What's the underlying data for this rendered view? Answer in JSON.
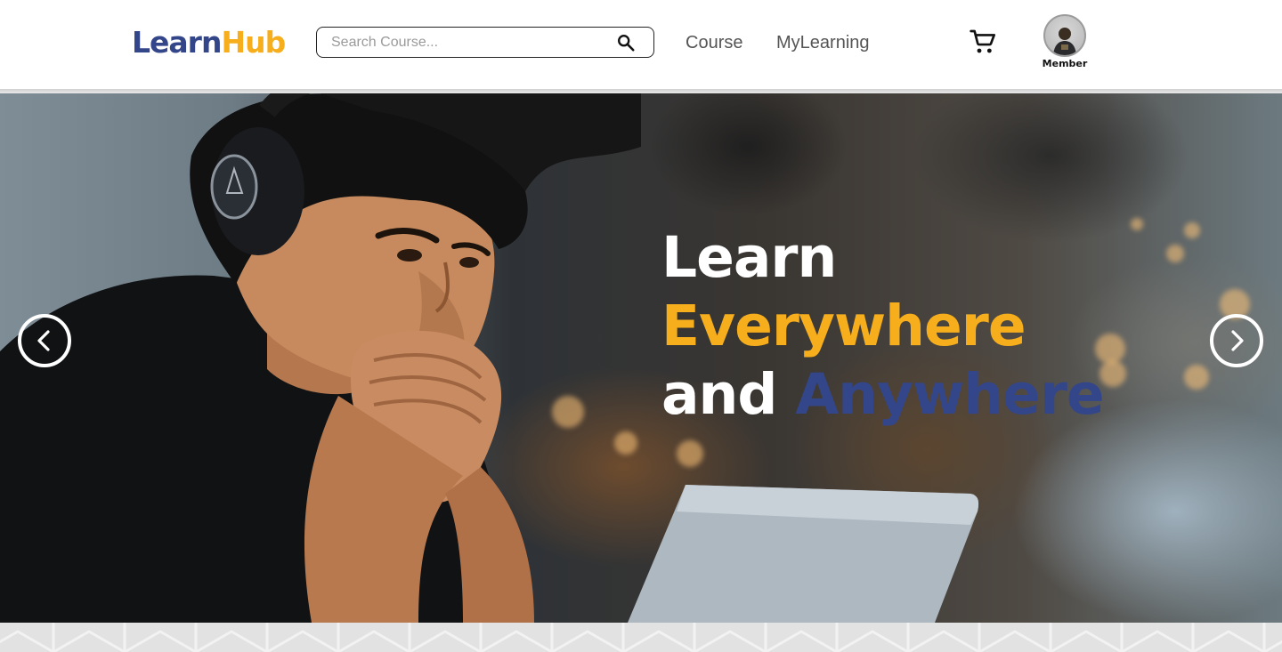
{
  "header": {
    "logo": {
      "part1": "Learn",
      "part2": "Hub"
    },
    "search": {
      "placeholder": "Search Course..."
    },
    "nav": {
      "course": "Course",
      "mylearning": "MyLearning"
    },
    "member_label": "Member"
  },
  "hero": {
    "line1": "Learn",
    "line2": "Everywhere",
    "line3_word1": "and",
    "line3_word2": "Anywhere"
  },
  "colors": {
    "brand_blue": "#34468a",
    "brand_orange": "#f6ae1c",
    "text_gray": "#555555"
  },
  "icons": {
    "search": "search-icon",
    "cart": "cart-icon",
    "prev": "chevron-left-icon",
    "next": "chevron-right-icon"
  }
}
